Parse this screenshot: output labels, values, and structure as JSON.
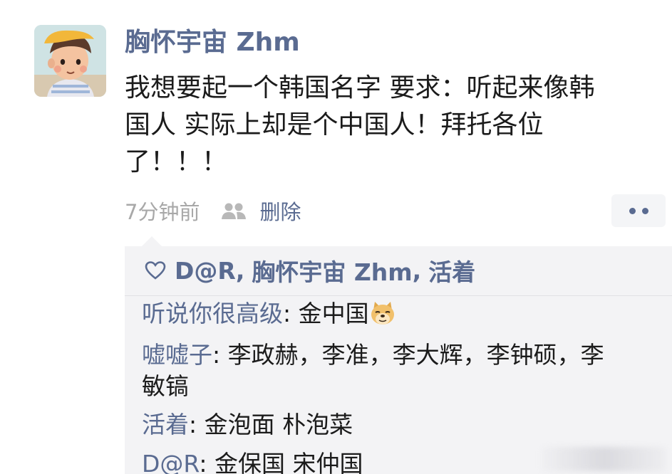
{
  "post": {
    "author": "胸怀宇宙 Zhm",
    "text_lines": [
      "我想要起一个韩国名字 要求：听起来像韩",
      "国人 实际上却是个中国人！拜托各位",
      "了！！！"
    ],
    "time": "7分钟前",
    "visibility_icon": "friends-icon",
    "delete_label": "删除",
    "more_icon": "more-dots-icon"
  },
  "likes": {
    "icon": "heart-outline-icon",
    "names": [
      "D@R",
      "胸怀宇宙 Zhm",
      "活着"
    ],
    "separator": ","
  },
  "comments": [
    {
      "name": "听说你很高级",
      "colon": ":",
      "lines": [
        "金中国"
      ],
      "emoji": "doge-emoji"
    },
    {
      "name": "嘘嘘子",
      "colon": ":",
      "lines": [
        "李政赫，李准，李大辉，李钟硕，李",
        "敏镐"
      ]
    },
    {
      "name": "活着",
      "colon": ":",
      "lines": [
        "金泡面 朴泡菜"
      ]
    },
    {
      "name": "D@R",
      "colon": ":",
      "lines": [
        "金保国 宋仲国"
      ]
    }
  ],
  "colors": {
    "link": "#5a6b91",
    "text": "#1b1b1b",
    "meta": "#a8a8a8",
    "comment_bg": "#f3f3f5"
  }
}
